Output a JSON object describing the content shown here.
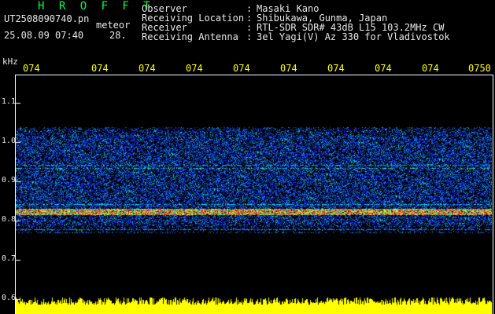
{
  "header": {
    "brand": "H R O F F T",
    "filename": "UT2508090740.pn",
    "meteor_label": "meteor",
    "date": "25.08.09 07:40",
    "count": "28."
  },
  "info": [
    {
      "key": "Observer",
      "sep": ":",
      "value": "Masaki Kano"
    },
    {
      "key": "Receiving Location",
      "sep": ":",
      "value": "Shibukawa, Gunma, Japan"
    },
    {
      "key": "Receiver",
      "sep": ":",
      "value": "RTL-SDR SDR# 43dB L15 103.2MHz CW"
    },
    {
      "key": "Receiving Antenna",
      "sep": ":",
      "value": "3el Yagi(V) Az 330 for Vladivostok"
    }
  ],
  "axis": {
    "unit": "kHz",
    "time_ticks": [
      "074",
      "074",
      "074",
      "074",
      "074",
      "074",
      "074",
      "074",
      "074",
      "0750"
    ],
    "freq_ticks": [
      "1.1",
      "1.0",
      "0.9",
      "0.8",
      "0.7",
      "0.6"
    ]
  },
  "colors": {
    "background": "#000000",
    "text": "#e8e8e8",
    "brand": "#00ff3c",
    "tick_labels": "#ffff00",
    "noise_low": "#1e3cff",
    "noise_high": "#00e6ff",
    "signal": "#ff2020",
    "amplitude": "#ffff00"
  }
}
